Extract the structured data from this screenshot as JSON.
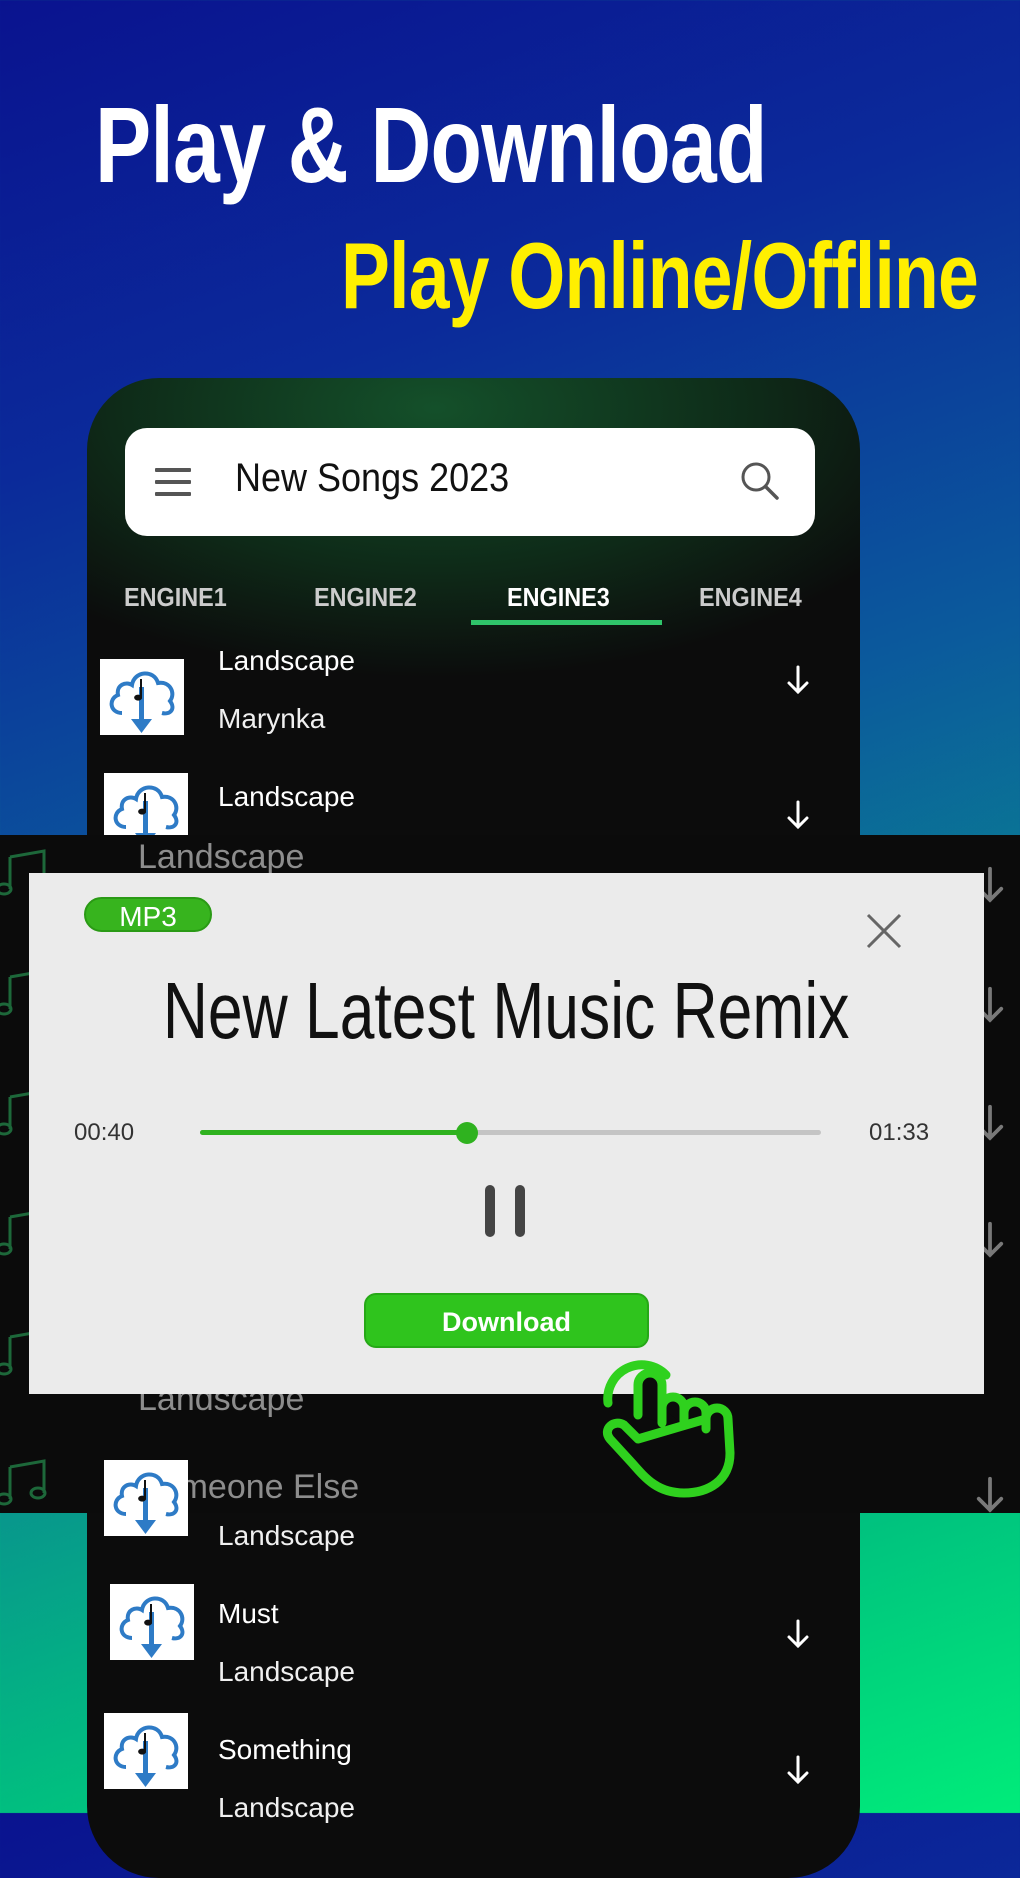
{
  "banner": {
    "headline": "Play & Download",
    "subheadline": "Play Online/Offline"
  },
  "colors": {
    "accent": "#2fc41d",
    "headline": "#ffffff",
    "subheadline": "#ffef00",
    "tab_indicator": "#2fc46a"
  },
  "search": {
    "icon_left": "menu-icon",
    "value": "New Songs 2023",
    "icon_right": "search-icon"
  },
  "tabs": [
    {
      "label": "ENGINE1"
    },
    {
      "label": "ENGINE2"
    },
    {
      "label": "ENGINE3",
      "active": true
    },
    {
      "label": "ENGINE4"
    }
  ],
  "songs_top": [
    {
      "title": "Landscape",
      "artist": "Marynka"
    },
    {
      "title": "Landscape"
    }
  ],
  "background_list": [
    "Landscape",
    "Landscape",
    "Someone Else"
  ],
  "dialog": {
    "badge": "MP3",
    "title": "New Latest Music Remix",
    "elapsed": "00:40",
    "duration": "01:33",
    "progress_fraction": 0.43,
    "download_label": "Download"
  },
  "songs_bottom": [
    {
      "artist": "Landscape"
    },
    {
      "title": "Must",
      "artist": "Landscape"
    },
    {
      "title": "Something",
      "artist": "Landscape"
    }
  ]
}
